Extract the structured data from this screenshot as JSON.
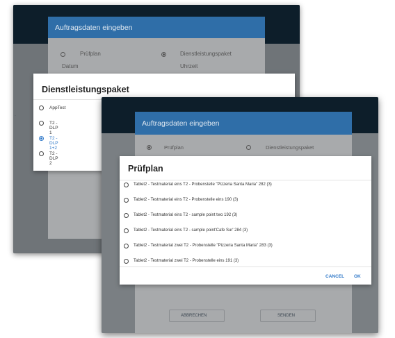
{
  "back": {
    "form": {
      "header": "Auftragsdaten eingeben",
      "radio_pruefplan": "Prüfplan",
      "radio_dienst": "Dienstleistungspaket",
      "datum_label": "Datum",
      "uhrzeit_label": "Uhrzeit"
    },
    "dialog": {
      "title": "Dienstleistungspaket",
      "options": [
        {
          "label": "AppTest",
          "selected": false
        },
        {
          "label": "T2 - DLP 1",
          "selected": false
        },
        {
          "label": "T2 - DLP 1+2",
          "selected": true
        },
        {
          "label": "T2 - DLP 2",
          "selected": false
        }
      ]
    }
  },
  "front": {
    "form": {
      "header": "Auftragsdaten eingeben",
      "radio_pruefplan": "Prüfplan",
      "radio_dienst": "Dienstleistungspaket",
      "btn_cancel": "ABBRECHEN",
      "btn_send": "SENDEN"
    },
    "dialog": {
      "title": "Prüfplan",
      "options": [
        "Tablet2 - Testmaterial eins T2 - Probenstelle \"Pizzeria Santa Maria\" 282 (3)",
        "Tablet2 - Testmaterial eins T2 - Probenstelle eins 190 (3)",
        "Tablet2 - Testmaterial eins T2 - sample point two 192 (3)",
        "Tablet2 - Testmaterial eins T2 - sample point'Cafe Sur' 284 (3)",
        "Tablet2 - Testmaterial zwei T2 - Probenstelle \"Pizzeria Santa Maria\" 283 (3)",
        "Tablet2 - Testmaterial zwei T2 - Probenstelle eins 191 (3)"
      ],
      "btn_cancel": "CANCEL",
      "btn_ok": "OK"
    }
  },
  "colors": {
    "accent": "#2f78c8",
    "header_blue": "#2f6ea8",
    "dark_band": "#0d1e2a"
  }
}
